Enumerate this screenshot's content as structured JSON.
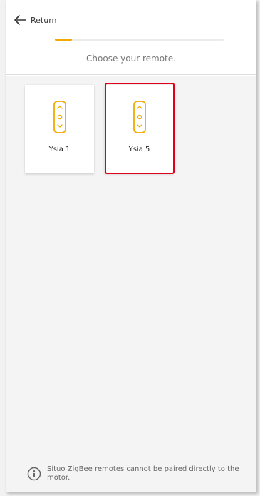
{
  "header": {
    "back_label": "Return",
    "step_title": "Choose your remote.",
    "progress_fraction": 0.1
  },
  "remotes": [
    {
      "name": "Ysia 1",
      "icon": "remote-icon",
      "selected": false
    },
    {
      "name": "Ysia 5",
      "icon": "remote-icon",
      "selected": true
    }
  ],
  "footer": {
    "note": "Situo ZigBee remotes cannot be paired directly to the motor.",
    "icon": "info-icon"
  },
  "colors": {
    "accent": "#f2a900",
    "selection": "#e0001b",
    "background": "#f4f4f4"
  }
}
